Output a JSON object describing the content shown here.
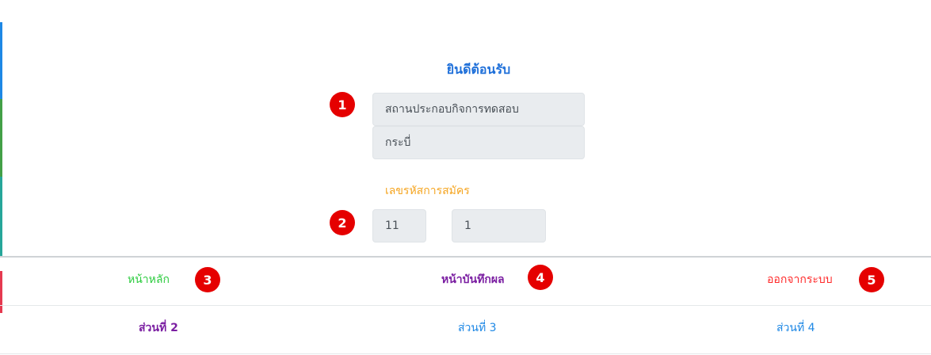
{
  "header": {
    "welcome": "ยินดีต้อนรับ"
  },
  "form": {
    "establishment_name": "สถานประกอบกิจการทดสอบ",
    "province": "กระบี่",
    "registration_label": "เลขรหัสการสมัคร",
    "code_part1": "11",
    "code_part2": "1"
  },
  "callouts": [
    "1",
    "2",
    "3",
    "4",
    "5"
  ],
  "nav": {
    "row1": {
      "home": "หน้าหลัก",
      "record": "หน้าบันทึกผล",
      "logout": "ออกจากระบบ"
    },
    "row2": {
      "part2": "ส่วนที่ 2",
      "part3": "ส่วนที่ 3",
      "part4": "ส่วนที่ 4"
    }
  },
  "colors": {
    "welcome": "#1e6fd9",
    "registration_label": "#f5a623",
    "home": "#2ecc40",
    "record": "#7b1fa2",
    "logout": "#ff2a2a",
    "badge": "#e50000",
    "field_bg": "#e9ecef"
  }
}
